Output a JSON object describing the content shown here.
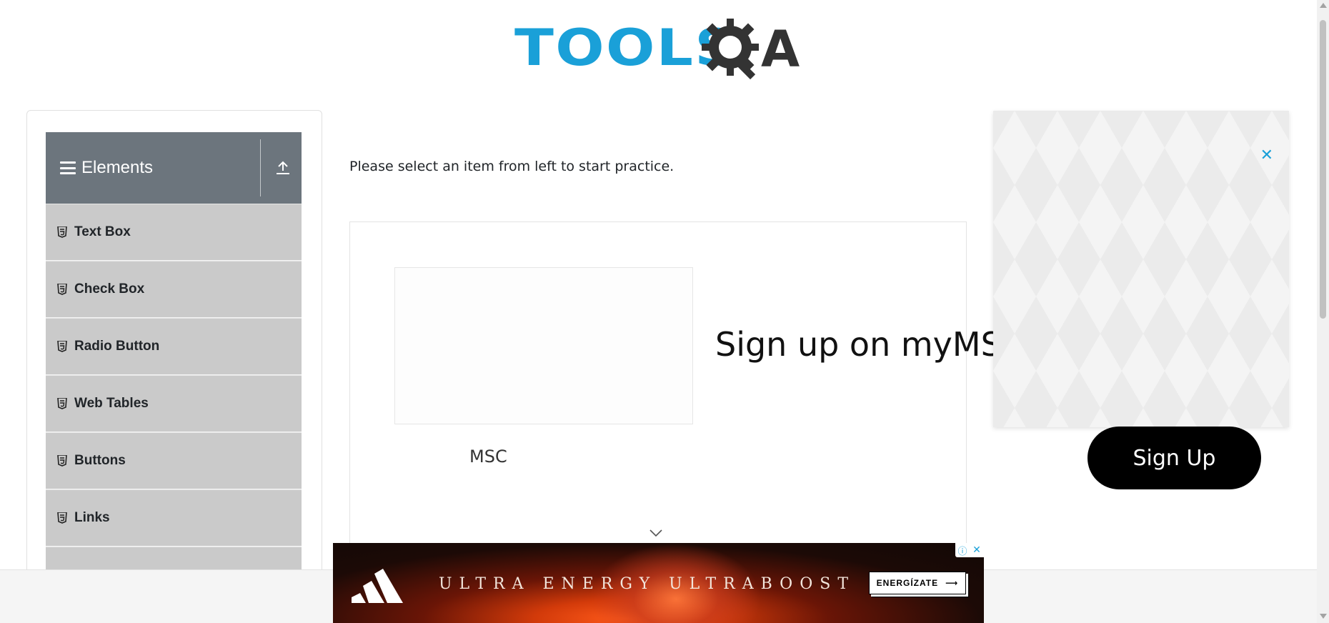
{
  "logo": {
    "part1": "TOOLS",
    "part2": "A",
    "gear_icon": "gear-magnifier-icon"
  },
  "sidebar": {
    "group_title": "Elements",
    "group_icon": "hamburger-icon",
    "toggle_icon": "upload-arrow-icon",
    "items": [
      {
        "label": "Text Box",
        "icon": "html5-icon"
      },
      {
        "label": "Check Box",
        "icon": "html5-icon"
      },
      {
        "label": "Radio Button",
        "icon": "html5-icon"
      },
      {
        "label": "Web Tables",
        "icon": "html5-icon"
      },
      {
        "label": "Buttons",
        "icon": "html5-icon"
      },
      {
        "label": "Links",
        "icon": "html5-icon"
      }
    ]
  },
  "main": {
    "prompt": "Please select an item from left to start practice."
  },
  "inline_ad": {
    "heading": "Sign up on myMSC",
    "brand_label": "MSC",
    "cta": "Sign Up",
    "chevron_icon": "chevron-down-icon"
  },
  "popup_ad": {
    "close_label": "✕"
  },
  "bottom_ad": {
    "slogan": "ULTRA ENERGY  ULTRABOOST",
    "cta_label": "ENERGÍZATE",
    "cta_arrow": "⟶",
    "info_label": "ⓘ",
    "close_label": "✕"
  },
  "colors": {
    "brand_blue": "#1aa0d8",
    "sidebar_header": "#6c757d",
    "sidebar_item": "#cacaca",
    "cta_black": "#000000"
  }
}
